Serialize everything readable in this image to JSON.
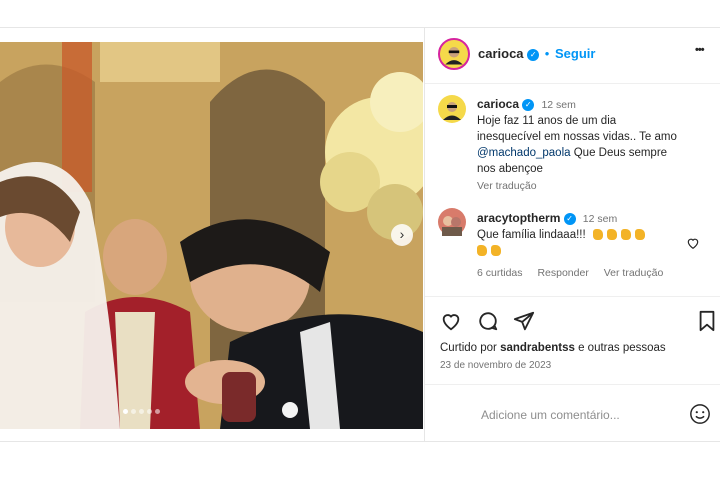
{
  "header": {
    "username": "carioca",
    "separator": "•",
    "follow_label": "Seguir",
    "more_label": "•••"
  },
  "caption": {
    "username": "carioca",
    "time": "12 sem",
    "text_line1": "Hoje faz 11 anos de um dia",
    "text_line2": "inesquecível em nossas vidas.. Te amo",
    "mention": "@machado_paola",
    "text_after_mention": "Que Deus sempre",
    "text_line4": "nos abençoe",
    "translate_label": "Ver tradução"
  },
  "comment": {
    "username": "aracytoptherm",
    "time": "12 sem",
    "text": "Que família lindaaa!!!",
    "likes_label": "6 curtidas",
    "reply_label": "Responder",
    "translate_label": "Ver tradução"
  },
  "actions": {
    "liked_by_prefix": "Curtido por",
    "liked_by_user": "sandrabentss",
    "liked_by_suffix": "e outras pessoas",
    "date": "23 de novembro de 2023"
  },
  "add_comment": {
    "placeholder": "Adicione um comentário..."
  },
  "carousel": {
    "dot_count": 5,
    "active_dot": 0
  },
  "colors": {
    "accent": "#0095f6",
    "link": "#00376b",
    "emoji": "#f3b327"
  }
}
